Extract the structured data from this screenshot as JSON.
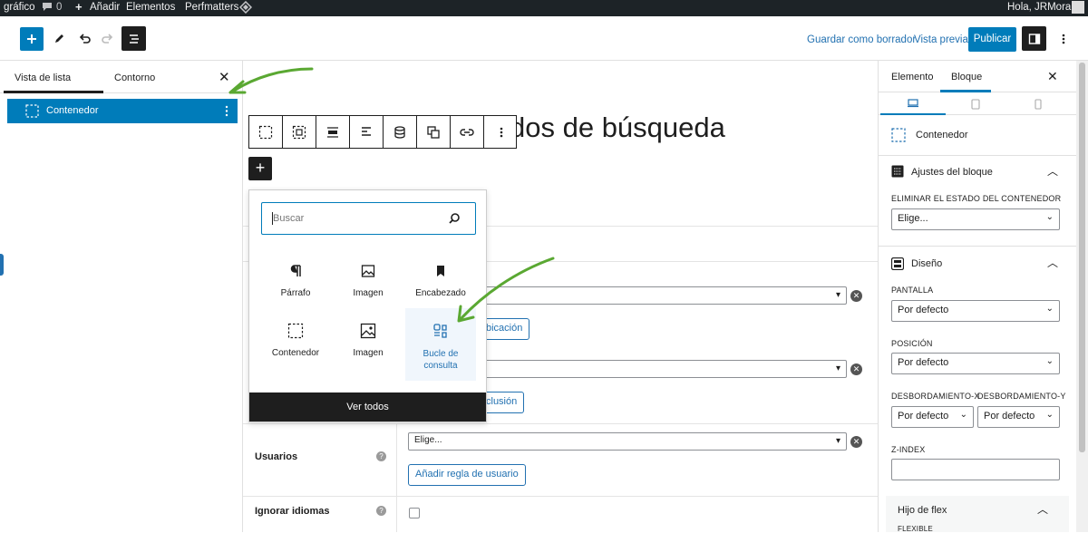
{
  "admin_bar": {
    "site": "gráfico",
    "comments_count": "0",
    "add_new": "Añadir",
    "elements": "Elementos",
    "perfmatters": "Perfmatters",
    "greeting": "Hola, JRMora"
  },
  "toolbar": {
    "save_draft": "Guardar como borrador",
    "preview": "Vista previa",
    "publish": "Publicar"
  },
  "left_panel": {
    "tab_list": "Vista de lista",
    "tab_outline": "Contorno",
    "selected_item": "Contenedor"
  },
  "canvas": {
    "title_partial": "dos de búsqueda",
    "rows": [
      {
        "label": "",
        "select_value": "",
        "button": "bicación"
      },
      {
        "label": "",
        "select_value": "",
        "button": "clusión"
      },
      {
        "label": "Usuarios",
        "select_value": "Elige...",
        "button": "Añadir regla de usuario"
      },
      {
        "label": "Ignorar idiomas",
        "select_value": "",
        "button": ""
      }
    ]
  },
  "inserter": {
    "search_placeholder": "Buscar",
    "blocks": [
      {
        "label": "Párrafo",
        "icon": "paragraph-icon"
      },
      {
        "label": "Imagen",
        "icon": "image-icon"
      },
      {
        "label": "Encabezado",
        "icon": "bookmark-icon"
      },
      {
        "label": "Contenedor",
        "icon": "container-icon"
      },
      {
        "label": "Imagen",
        "icon": "image-icon"
      },
      {
        "label": "Bucle de consulta",
        "icon": "query-loop-icon"
      }
    ],
    "view_all": "Ver todos"
  },
  "right_panel": {
    "tab_element": "Elemento",
    "tab_block": "Bloque",
    "block_name": "Contenedor",
    "block_settings_title": "Ajustes del bloque",
    "remove_state_label": "ELIMINAR EL ESTADO DEL CONTENEDOR",
    "remove_state_value": "Elige...",
    "design_title": "Diseño",
    "screen_label": "PANTALLA",
    "screen_value": "Por defecto",
    "position_label": "POSICIÓN",
    "position_value": "Por defecto",
    "overflow_x_label": "DESBORDAMIENTO-X",
    "overflow_x_value": "Por defecto",
    "overflow_y_label": "DESBORDAMIENTO-Y",
    "overflow_y_value": "Por defecto",
    "zindex_label": "Z-INDEX",
    "flex_child_title": "Hijo de flex",
    "flexible_label": "FLEXIBLE"
  },
  "colors": {
    "accent": "#2271b1",
    "selected": "#007cba",
    "admin_bar": "#1d2327",
    "annotation_arrow": "#5aa832"
  }
}
